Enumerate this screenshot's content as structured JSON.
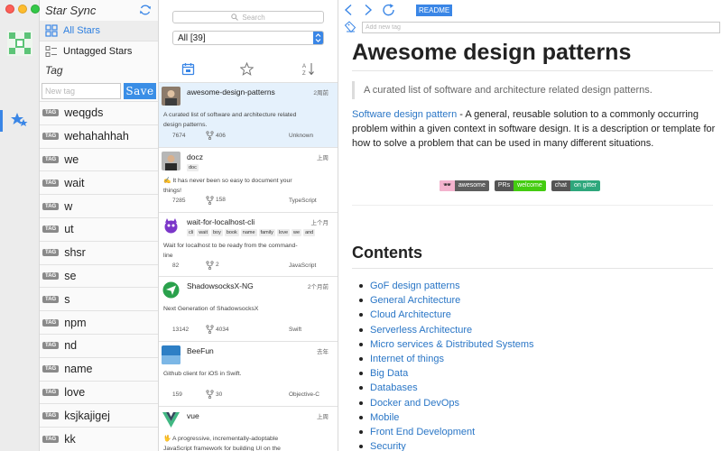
{
  "sidebar": {
    "app_title": "Star Sync",
    "nav": [
      {
        "label": "All Stars",
        "icon": "grid-icon"
      },
      {
        "label": "Untagged Stars",
        "icon": "list-icon"
      }
    ],
    "tag_heading": "Tag",
    "new_tag_placeholder": "New tag",
    "save_label": "Save",
    "tag_badge": "TAG",
    "tags": [
      "weqgds",
      "wehahahhah",
      "we",
      "wait",
      "w",
      "ut",
      "shsr",
      "se",
      "s",
      "npm",
      "nd",
      "name",
      "love",
      "ksjkajigej",
      "kk"
    ]
  },
  "repo_list": {
    "search_placeholder": "Search",
    "filter_value": "All  [39]",
    "sort_icons": [
      "calendar-icon",
      "star-icon",
      "sort-alpha-icon"
    ],
    "repos": [
      {
        "name": "awesome-design-patterns",
        "time": "2周前",
        "topics": [],
        "description": "A curated list of software and architecture related design patterns.",
        "stars": "7674",
        "forks": "406",
        "language": "Unknown"
      },
      {
        "name": "docz",
        "time": "上周",
        "topics": [
          "doc"
        ],
        "description": "✍ It has never been so easy to document your things!",
        "stars": "7285",
        "forks": "158",
        "language": "TypeScript"
      },
      {
        "name": "wait-for-localhost-cli",
        "time": "上个月",
        "topics": [
          "cli",
          "wait",
          "boy",
          "book",
          "name",
          "family",
          "love",
          "we",
          "and"
        ],
        "description": "Wait for localhost to be ready from the command-line",
        "stars": "82",
        "forks": "2",
        "language": "JavaScript"
      },
      {
        "name": "ShadowsocksX-NG",
        "time": "2个月前",
        "topics": [],
        "description": "Next Generation of ShadowsocksX",
        "stars": "13142",
        "forks": "4034",
        "language": "Swift"
      },
      {
        "name": "BeeFun",
        "time": "去年",
        "topics": [],
        "description": "Github client for iOS in Swift.",
        "stars": "159",
        "forks": "30",
        "language": "Objective-C"
      },
      {
        "name": "vue",
        "time": "上周",
        "topics": [],
        "description": "🖖 A progressive, incrementally-adoptable JavaScript framework for building UI on the",
        "stars": "",
        "forks": "",
        "language": ""
      }
    ]
  },
  "readme": {
    "tab_label": "README",
    "new_tag_placeholder": "Add new tag",
    "title": "Awesome design patterns",
    "quote": "A curated list of software and architecture related design patterns.",
    "intro_link": "Software design pattern",
    "intro_text": " - A general, reusable solution to a commonly occurring problem within a given context in software design. It is a description or template for how to solve a problem that can be used in many different situations.",
    "badges": [
      {
        "left": "🕶",
        "right": "awesome"
      },
      {
        "left": "PRs",
        "right": "welcome"
      },
      {
        "left": "chat",
        "right": "on gitter"
      }
    ],
    "contents_heading": "Contents",
    "contents": [
      "GoF design patterns",
      "General Architecture",
      "Cloud Architecture",
      "Serverless Architecture",
      "Micro services & Distributed Systems",
      "Internet of things",
      "Big Data",
      "Databases",
      "Docker and DevOps",
      "Mobile",
      "Front End Development",
      "Security"
    ]
  }
}
